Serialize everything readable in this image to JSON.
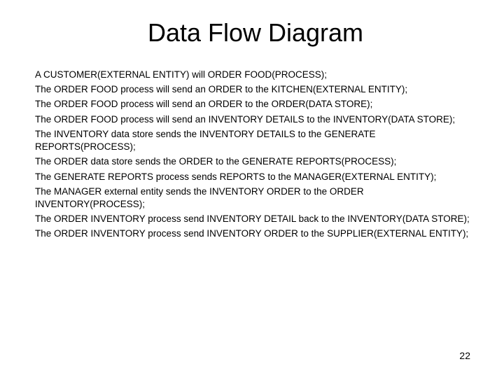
{
  "title": "Data Flow Diagram",
  "lines": [
    "A CUSTOMER(EXTERNAL ENTITY) will ORDER FOOD(PROCESS);",
    "The ORDER FOOD process will send an ORDER to the KITCHEN(EXTERNAL ENTITY);",
    "The ORDER FOOD process will send an ORDER to the ORDER(DATA STORE);",
    "The ORDER FOOD process will send an INVENTORY DETAILS to the INVENTORY(DATA STORE);",
    "The INVENTORY data store sends the INVENTORY DETAILS to the GENERATE REPORTS(PROCESS);",
    "The ORDER data store sends the ORDER to the GENERATE REPORTS(PROCESS);",
    "The GENERATE REPORTS process sends REPORTS to the MANAGER(EXTERNAL ENTITY);",
    "The MANAGER external entity sends the INVENTORY ORDER  to the ORDER INVENTORY(PROCESS);",
    "The ORDER INVENTORY process send INVENTORY DETAIL back to the INVENTORY(DATA STORE);",
    "The ORDER INVENTORY process send INVENTORY ORDER to the SUPPLIER(EXTERNAL ENTITY);"
  ],
  "page_number": "22"
}
